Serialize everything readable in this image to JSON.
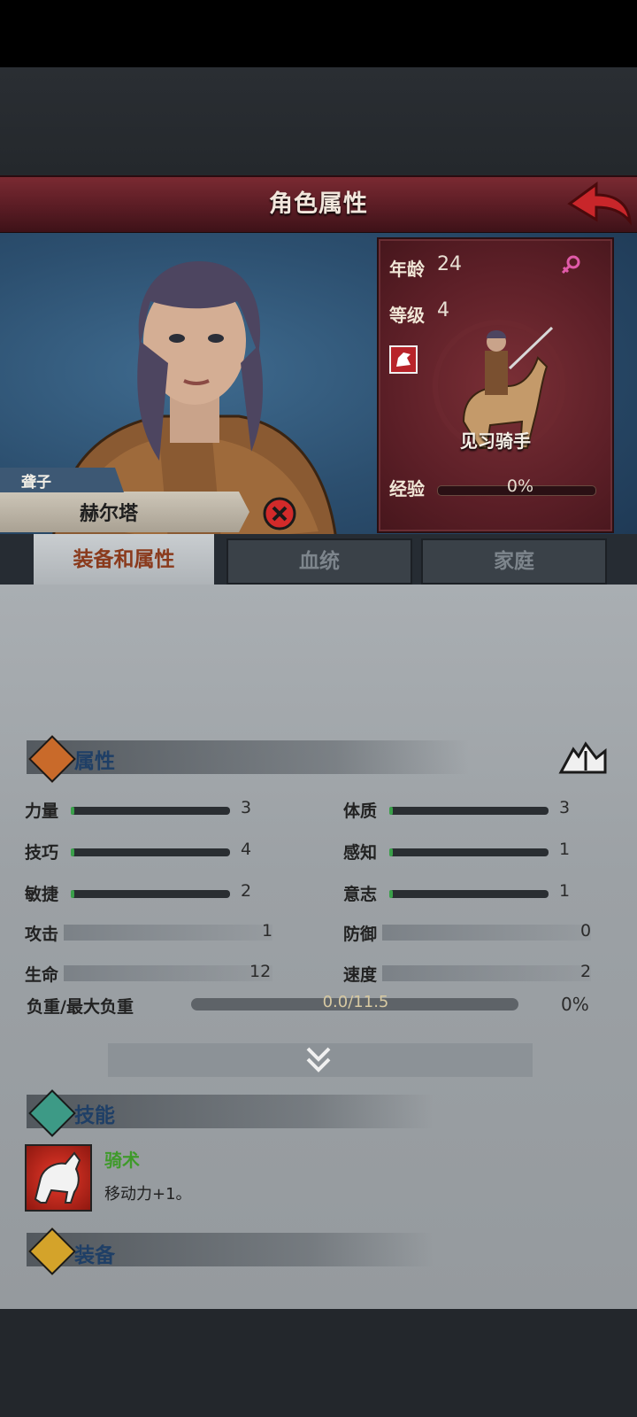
{
  "header": {
    "title": "角色属性",
    "back_icon": "back-arrow-icon"
  },
  "character": {
    "title_tag": "聋子",
    "name": "赫尔塔",
    "age_label": "年龄",
    "age": "24",
    "level_label": "等级",
    "level": "4",
    "gender_icon": "female-icon",
    "class_name": "见习骑手",
    "exp_label": "经验",
    "exp_pct": "0%",
    "exp_fraction": 0.0
  },
  "tabs": [
    {
      "label": "装备和属性",
      "active": true
    },
    {
      "label": "血统",
      "active": false
    },
    {
      "label": "家庭",
      "active": false
    }
  ],
  "attributes": {
    "section_title": "属性",
    "left": [
      {
        "label": "力量",
        "value": "3",
        "fill": 0.02
      },
      {
        "label": "技巧",
        "value": "4",
        "fill": 0.02
      },
      {
        "label": "敏捷",
        "value": "2",
        "fill": 0.0
      }
    ],
    "right": [
      {
        "label": "体质",
        "value": "3",
        "fill": 0.02
      },
      {
        "label": "感知",
        "value": "1",
        "fill": 0.0
      },
      {
        "label": "意志",
        "value": "1",
        "fill": 0.0
      }
    ],
    "combat": [
      {
        "label": "攻击",
        "value": "1"
      },
      {
        "label": "防御",
        "value": "0"
      },
      {
        "label": "生命",
        "value": "12"
      },
      {
        "label": "速度",
        "value": "2"
      }
    ],
    "load_label": "负重/最大负重",
    "load_value": "0.0/11.5",
    "load_pct": "0%"
  },
  "skills": {
    "section_title": "技能",
    "items": [
      {
        "name": "骑术",
        "desc": "移动力+1。",
        "icon": "horse-icon"
      }
    ]
  },
  "equipment": {
    "section_title": "装备"
  },
  "colors": {
    "header": "#6a232b",
    "skill_name": "#3f9a2a",
    "section_title": "#1f3f66"
  }
}
